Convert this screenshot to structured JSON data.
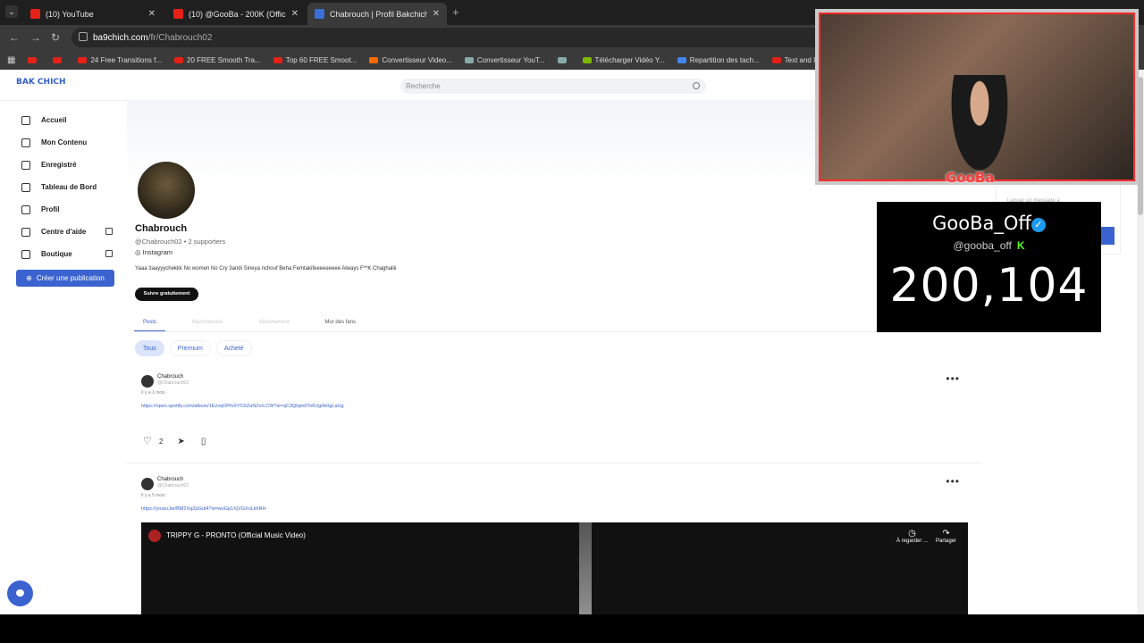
{
  "tabs": [
    {
      "label": "(10) YouTube",
      "icon": "youtube-icon"
    },
    {
      "label": "(10) @GooBa - 200K (Official A",
      "icon": "youtube-icon"
    },
    {
      "label": "Chabrouch | Profil Bakchich | Ba",
      "icon": "bakchich-icon"
    }
  ],
  "url": {
    "site": "ba9chich.com",
    "path": "/fr/Chabrouch02"
  },
  "bookmarks": [
    {
      "label": "",
      "icon": "youtube-icon"
    },
    {
      "label": "",
      "icon": "youtube-icon"
    },
    {
      "label": "24 Free Transitions f...",
      "icon": "youtube-icon"
    },
    {
      "label": "20 FREE Smooth Tra...",
      "icon": "youtube-icon"
    },
    {
      "label": "Top 60 FREE Smoot...",
      "icon": "youtube-icon"
    },
    {
      "label": "Convertisseur Video...",
      "icon": "z-icon"
    },
    {
      "label": "Convertisseur YouT...",
      "icon": "convert-icon"
    },
    {
      "label": "",
      "icon": "globe-icon"
    },
    {
      "label": "Télécharger Vidéo Y...",
      "icon": "download-icon"
    },
    {
      "label": "Repartition des tach...",
      "icon": "doc-icon"
    },
    {
      "label": "Text and Image ani...",
      "icon": "youtube-icon"
    }
  ],
  "header": {
    "logo": "BAK CHICH",
    "search_placeholder": "Recherche"
  },
  "sidebar": {
    "items": [
      {
        "label": "Accueil",
        "icon": "home-icon"
      },
      {
        "label": "Mon Contenu",
        "icon": "menu-icon"
      },
      {
        "label": "Enregistré",
        "icon": "bookmark-icon"
      },
      {
        "label": "Tableau de Bord",
        "icon": "dashboard-icon"
      },
      {
        "label": "Profil",
        "icon": "user-icon"
      },
      {
        "label": "Centre d'aide",
        "icon": "info-icon"
      },
      {
        "label": "Boutique",
        "icon": "shop-icon"
      }
    ],
    "create_label": "Créer une publication"
  },
  "profile": {
    "name": "Chabrouch",
    "handle": "@Chabrouch02 • 2 supporters",
    "instagram": "Instagram",
    "bio": "Yaaa 3aayyychekkk No women No Cry 3andi Sineya nchouf Beha Femtakifeeeeeeeee Always F**K Chaghaliii",
    "follow_label": "Suivre gratuitement"
  },
  "profile_tabs": [
    "Posts",
    "Marchandise",
    "Abonnement",
    "Mur des fans"
  ],
  "filters": [
    "Tous",
    "Premium",
    "Acheté"
  ],
  "posts": [
    {
      "author": "Chabrouch",
      "handle": "@Chabrouch02",
      "time": "Il y a 1 mois",
      "link": "https://open.spotify.com/album/1EzvqOPfoXYC6ZaNZvrLCW?si=qC3QIqm6To6Ugrlb0gLaUg",
      "likes": "2"
    },
    {
      "author": "Chabrouch",
      "handle": "@Chabrouch02",
      "time": "Il y a 5 mois",
      "link": "https://youtu.be/BM2XqZpGuf4?si=woGp1XjVGXoLkhRH",
      "video_title": "TRIPPY G - PRONTO (Official Music Video)",
      "watch_later": "À regarder ...",
      "share": "Partager"
    }
  ],
  "overlay": {
    "streamer": "GooBa",
    "name": "GooBa_Off",
    "handle": "@gooba_off",
    "kick": "K",
    "count": "200,104",
    "panel_text": "Laisser un message à"
  },
  "colors": {
    "accent": "#3b63d0",
    "overlay_red": "#ff3b3b",
    "kick_green": "#53fc18"
  }
}
